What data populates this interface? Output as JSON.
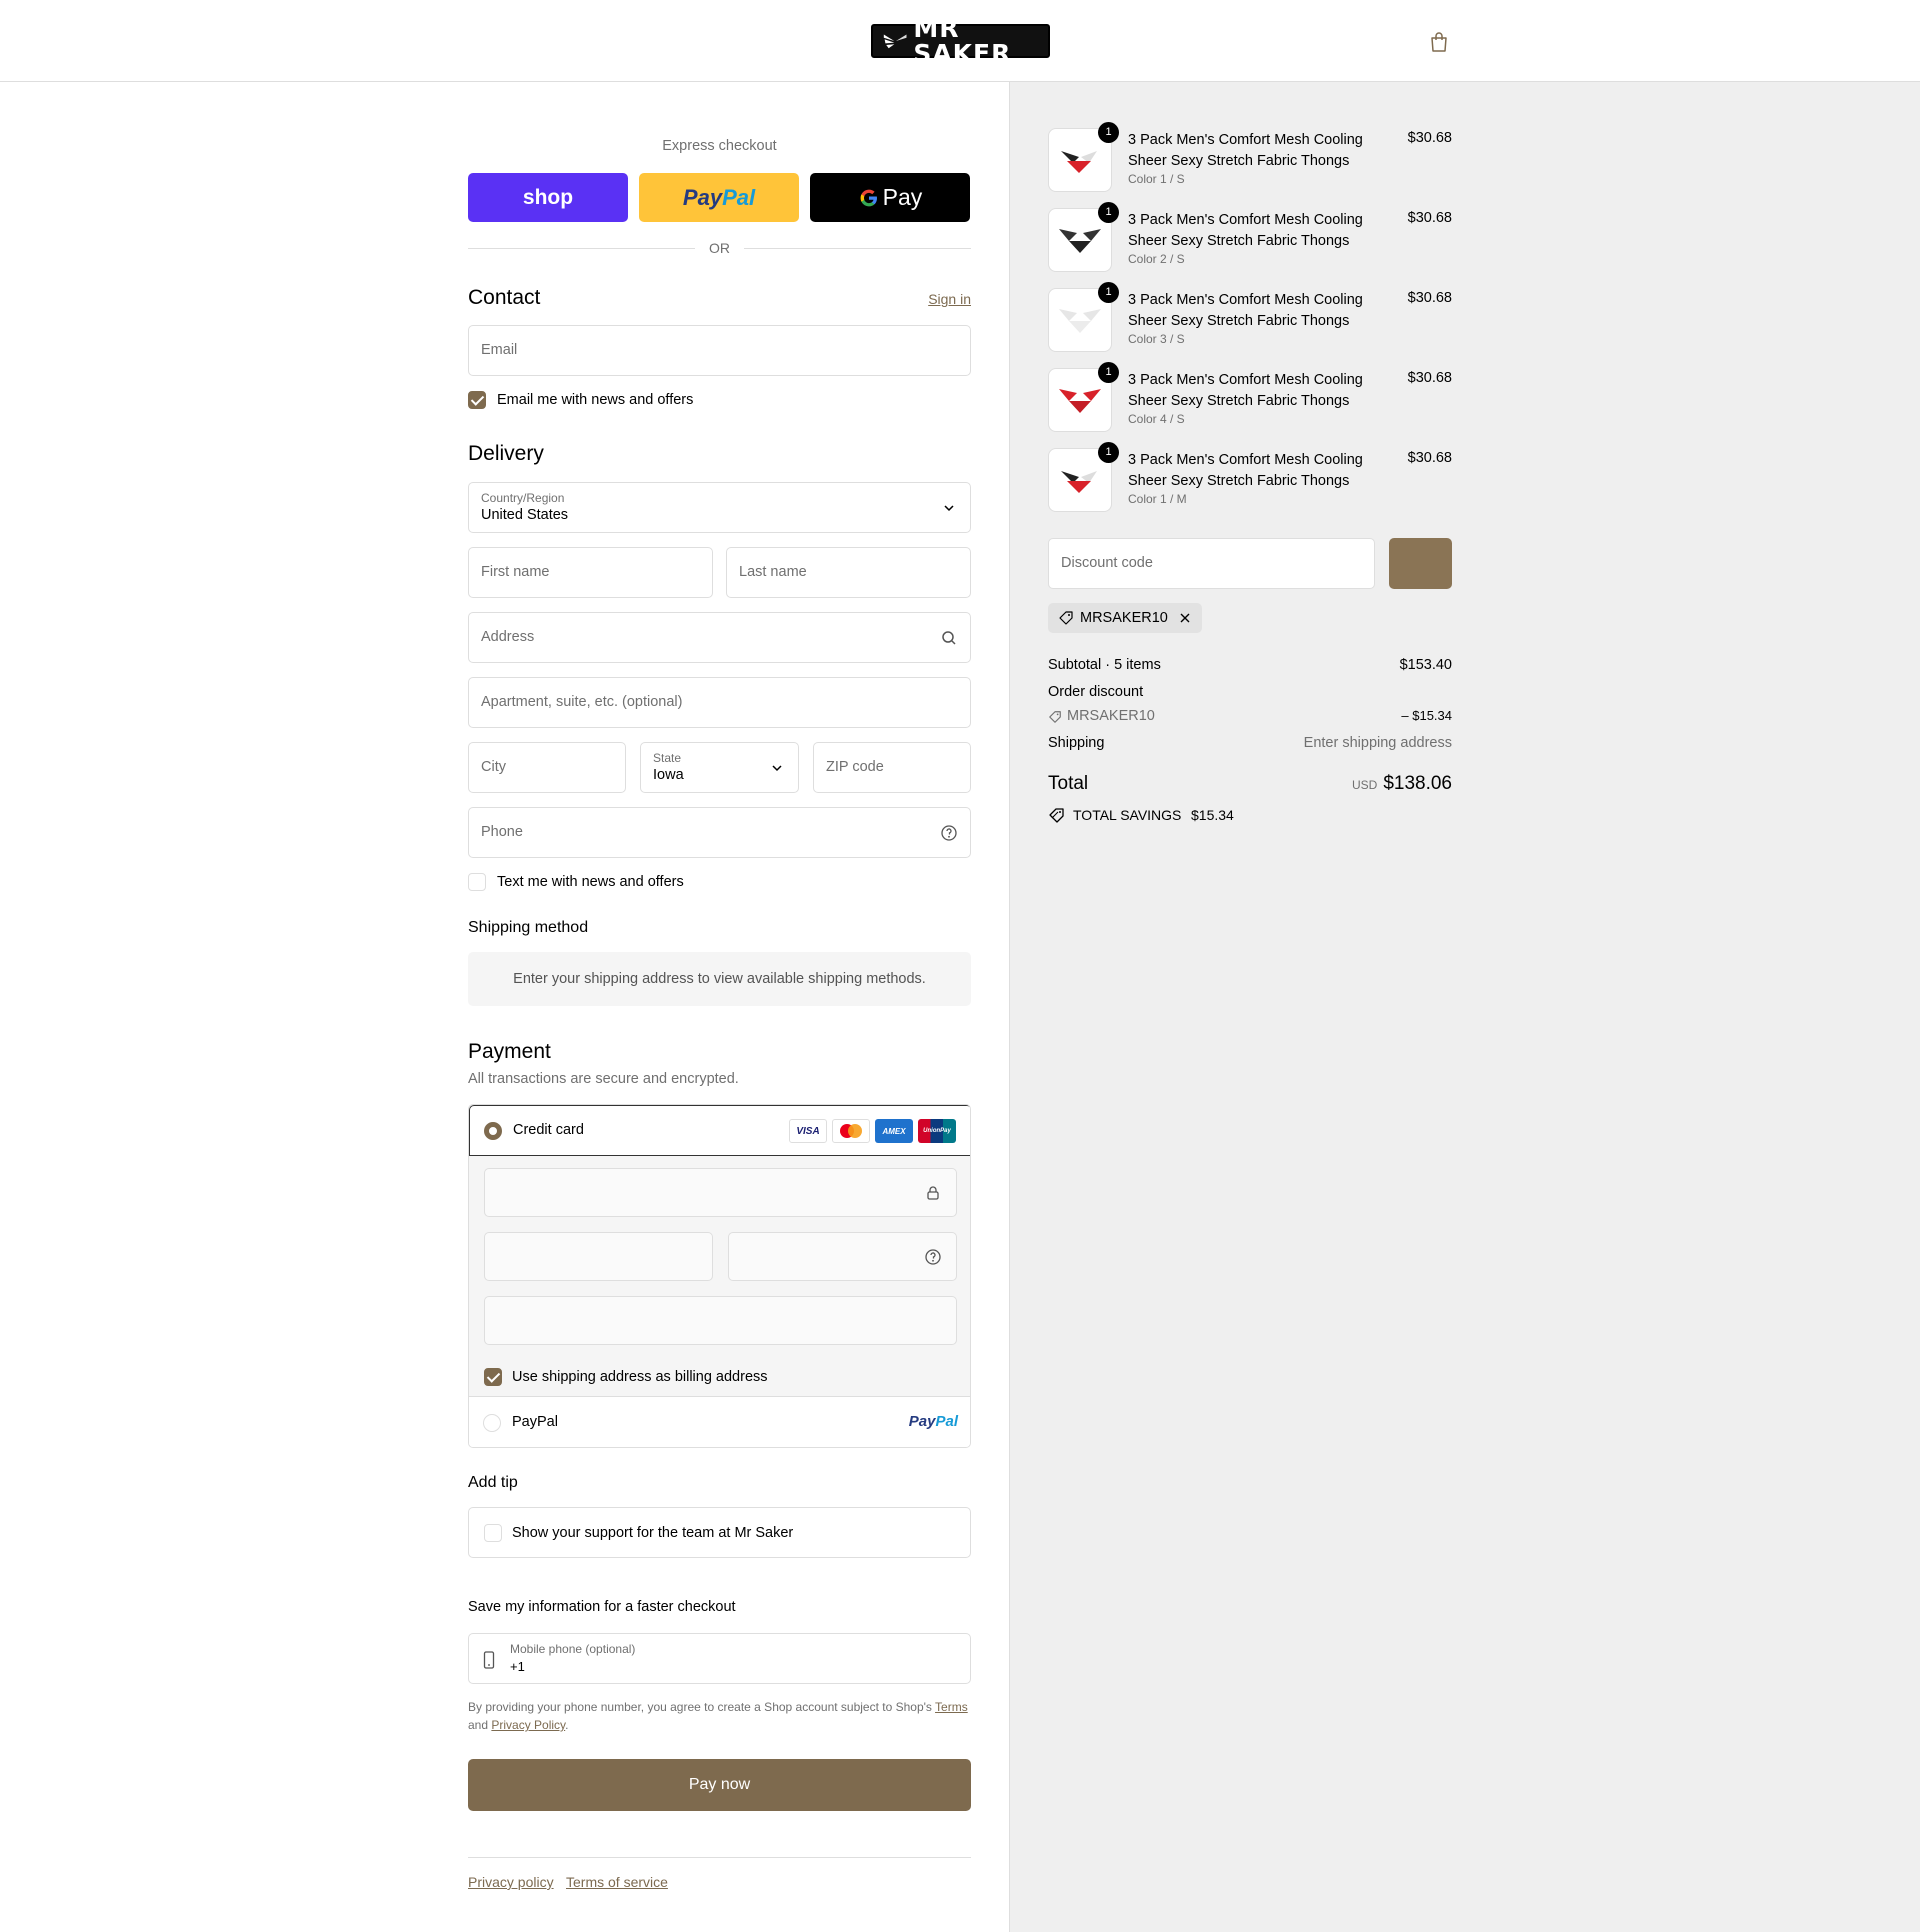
{
  "brand": {
    "logo_text": "MR SAKER"
  },
  "express": {
    "label": "Express checkout",
    "shop_label": "shop",
    "paypal_label_a": "Pay",
    "paypal_label_b": "Pal",
    "gpay_label": "Pay",
    "or_label": "OR"
  },
  "contact": {
    "heading": "Contact",
    "sign_in": "Sign in",
    "email_placeholder": "Email",
    "news_label": "Email me with news and offers",
    "news_checked": true
  },
  "delivery": {
    "heading": "Delivery",
    "country_label": "Country/Region",
    "country_value": "United States",
    "first_name_placeholder": "First name",
    "last_name_placeholder": "Last name",
    "address_placeholder": "Address",
    "apartment_placeholder": "Apartment, suite, etc. (optional)",
    "city_placeholder": "City",
    "state_label": "State",
    "state_value": "Iowa",
    "zip_placeholder": "ZIP code",
    "phone_placeholder": "Phone",
    "text_label": "Text me with news and offers",
    "text_checked": false
  },
  "shipping_method": {
    "heading": "Shipping method",
    "message": "Enter your shipping address to view available shipping methods."
  },
  "payment": {
    "heading": "Payment",
    "subtitle": "All transactions are secure and encrypted.",
    "credit_card_label": "Credit card",
    "card_brands": [
      "VISA",
      "Mastercard",
      "AMEX",
      "UnionPay"
    ],
    "billing_label": "Use shipping address as billing address",
    "billing_checked": true,
    "paypal_label": "PayPal",
    "paypal_logo_a": "Pay",
    "paypal_logo_b": "Pal"
  },
  "tip": {
    "heading": "Add tip",
    "label": "Show your support for the team at Mr Saker"
  },
  "save_info": {
    "heading": "Save my information for a faster checkout",
    "phone_label": "Mobile phone (optional)",
    "phone_value": "+1",
    "legal_prefix": "By providing your phone number, you agree to create a Shop account subject to Shop's",
    "terms_link": "Terms",
    "legal_and": "and",
    "privacy_link": "Privacy Policy",
    "legal_suffix": "."
  },
  "pay_now_label": "Pay now",
  "footer": {
    "privacy": "Privacy policy",
    "terms": "Terms of service"
  },
  "order": {
    "items": [
      {
        "qty": "1",
        "title": "3 Pack Men's Comfort Mesh Cooling Sheer Sexy Stretch Fabric Thongs",
        "variant": "Color 1 / S",
        "price": "$30.68"
      },
      {
        "qty": "1",
        "title": "3 Pack Men's Comfort Mesh Cooling Sheer Sexy Stretch Fabric Thongs",
        "variant": "Color 2 / S",
        "price": "$30.68"
      },
      {
        "qty": "1",
        "title": "3 Pack Men's Comfort Mesh Cooling Sheer Sexy Stretch Fabric Thongs",
        "variant": "Color 3 / S",
        "price": "$30.68"
      },
      {
        "qty": "1",
        "title": "3 Pack Men's Comfort Mesh Cooling Sheer Sexy Stretch Fabric Thongs",
        "variant": "Color 4 / S",
        "price": "$30.68"
      },
      {
        "qty": "1",
        "title": "3 Pack Men's Comfort Mesh Cooling Sheer Sexy Stretch Fabric Thongs",
        "variant": "Color 1 / M",
        "price": "$30.68"
      }
    ],
    "discount_placeholder": "Discount code",
    "applied_code": "MRSAKER10",
    "subtotal_label": "Subtotal · 5 items",
    "subtotal_value": "$153.40",
    "order_discount_label": "Order discount",
    "discount_code": "MRSAKER10",
    "discount_value": "– $15.34",
    "shipping_label": "Shipping",
    "shipping_value": "Enter shipping address",
    "total_label": "Total",
    "currency": "USD",
    "total_value": "$138.06",
    "savings_label": "TOTAL SAVINGS",
    "savings_value": "$15.34"
  },
  "colors": {
    "accent": "#7e6a4e",
    "shop": "#5a31f4",
    "paypal": "#ffc439",
    "sidebar_bg": "#efefef"
  }
}
